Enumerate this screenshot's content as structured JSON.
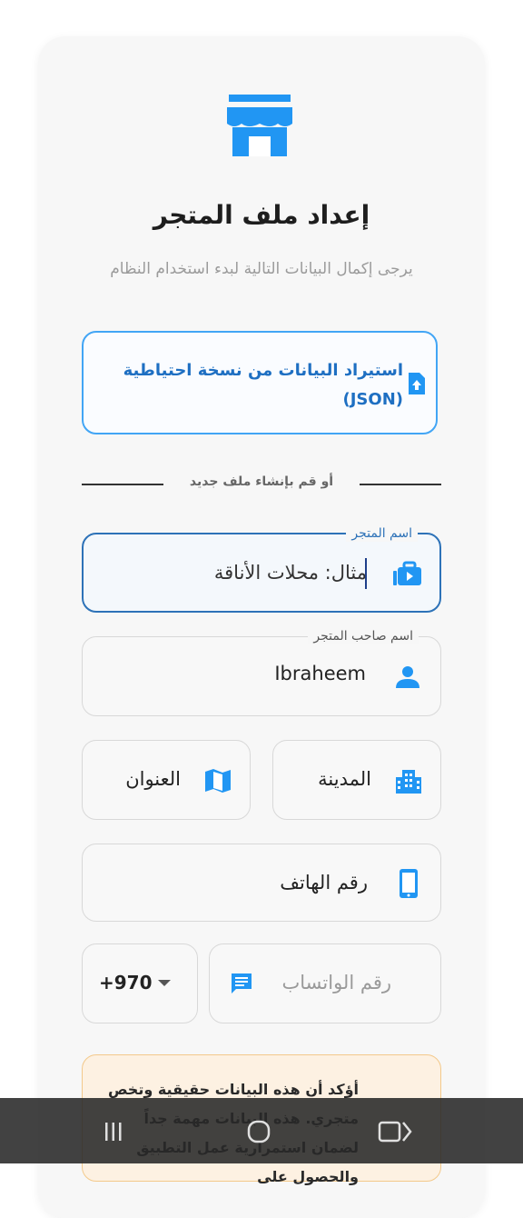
{
  "header": {
    "icon": "storefront-icon",
    "title": "إعداد ملف المتجر",
    "subtitle": "يرجى إكمال البيانات التالية لبدء استخدام النظام"
  },
  "import_button": {
    "label": "استيراد البيانات من نسخة احتياطية (JSON)",
    "icon": "upload-file-icon"
  },
  "divider": {
    "text": "أو قم بإنشاء ملف جديد"
  },
  "form": {
    "store_name": {
      "label": "اسم المتجر",
      "placeholder": "مثال: محلات الأناقة",
      "value": ""
    },
    "owner_name": {
      "label": "اسم صاحب المتجر",
      "value": "Ibraheem"
    },
    "city": {
      "placeholder": "المدينة"
    },
    "address": {
      "placeholder": "العنوان"
    },
    "phone": {
      "placeholder": "رقم الهاتف"
    },
    "whatsapp": {
      "placeholder": "رقم الواتساب"
    },
    "country_code": {
      "value": "+970"
    }
  },
  "notice": {
    "text": "أؤكد أن هذه البيانات حقيقية وتخص متجري. هذه البيانات مهمة جداً لضمان استمرارية عمل التطبيق والحصول على"
  },
  "colors": {
    "accent": "#2196f3",
    "focus_border": "#2d72b8",
    "import_border": "#42a5f5",
    "notice_bg": "#fdf1e2"
  }
}
